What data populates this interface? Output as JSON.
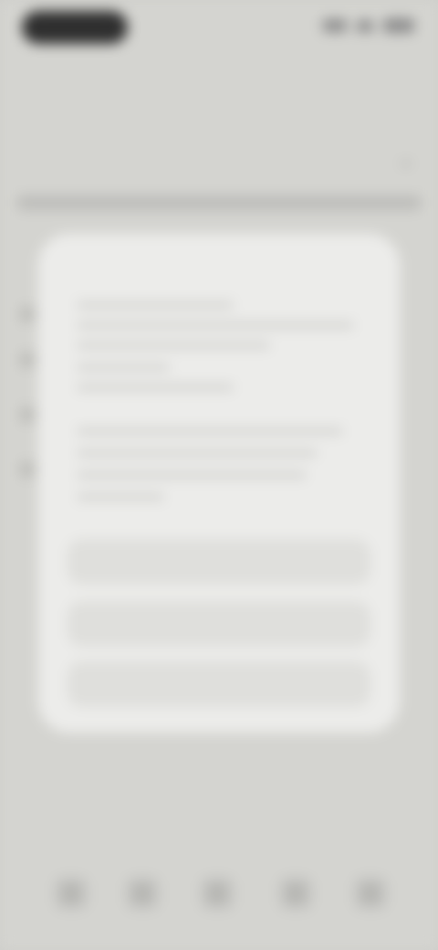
{
  "status_bar": {
    "time": "",
    "icons": [
      "signal-icon",
      "wifi-icon",
      "battery-icon"
    ]
  },
  "header": {
    "title": ""
  },
  "section": {
    "label": "",
    "chevron_icon": "chevron-down-icon"
  },
  "modal": {
    "title": "",
    "buttons": [
      {
        "label": ""
      },
      {
        "label": ""
      },
      {
        "label": ""
      }
    ]
  },
  "bottom_nav": {
    "items": [
      {
        "icon": "home-icon"
      },
      {
        "icon": "search-icon"
      },
      {
        "icon": "grid-icon"
      },
      {
        "icon": "bell-icon"
      },
      {
        "icon": "profile-icon"
      }
    ]
  }
}
